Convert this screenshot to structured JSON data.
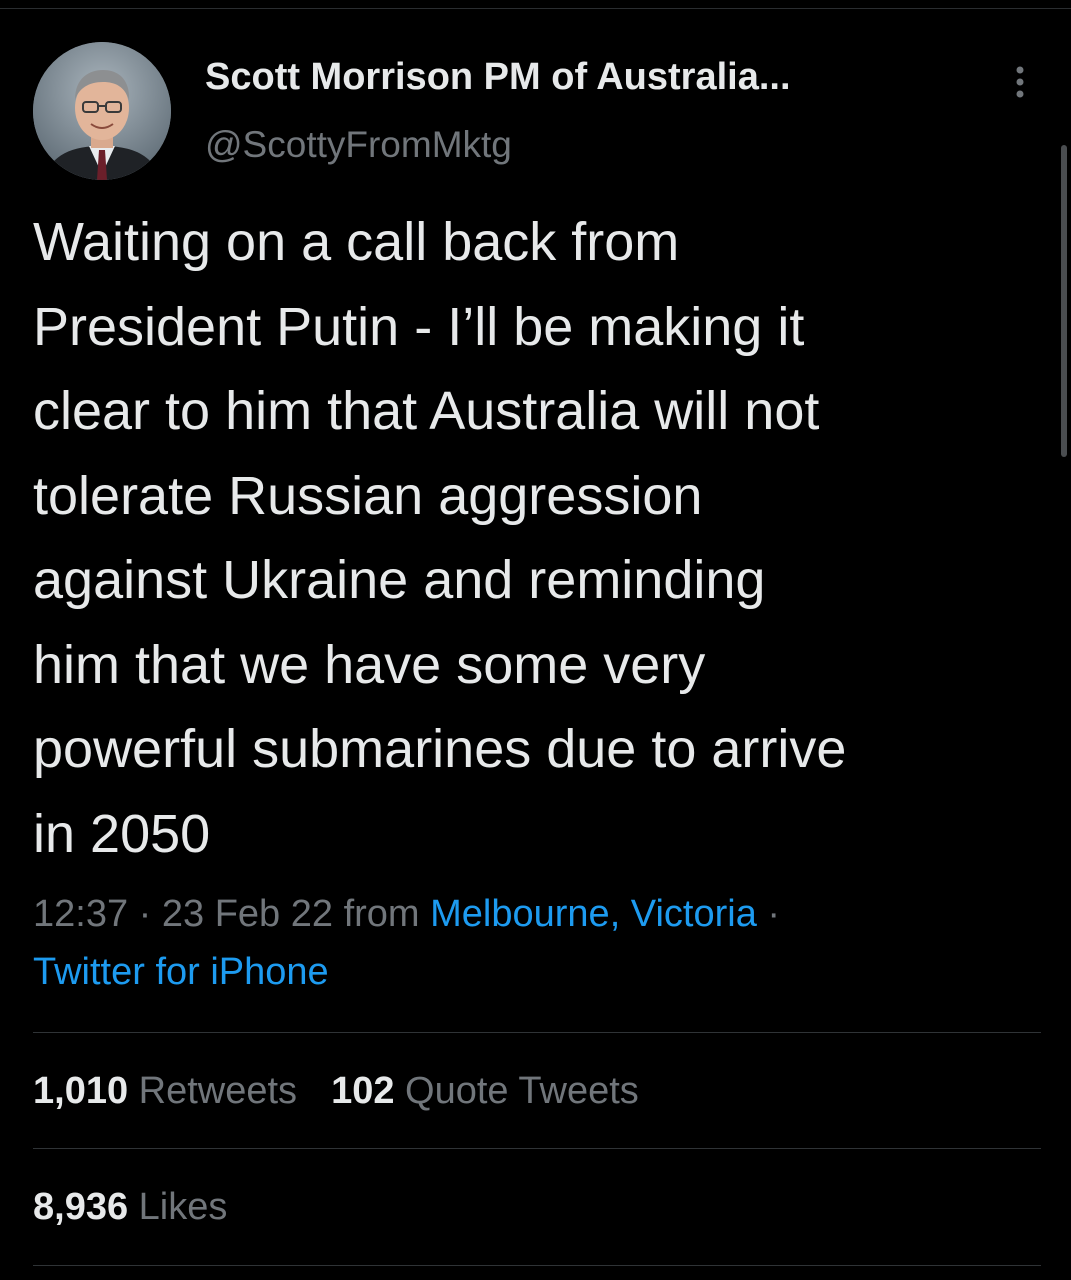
{
  "tweet": {
    "author_name": "Scott Morrison PM of Australia...",
    "author_handle": "@ScottyFromMktg",
    "text_lines": [
      "Waiting on a call back from",
      "President Putin - I’ll be making it",
      "clear to him that Australia will not",
      "tolerate Russian aggression",
      "against Ukraine and reminding",
      "him that we have some very",
      "powerful submarines due to arrive",
      "in 2050"
    ],
    "time": "12:37",
    "separator": " · ",
    "date": "23 Feb 22",
    "from_word": " from ",
    "location": "Melbourne, Victoria",
    "trailing_separator": " ·",
    "source": "Twitter for iPhone"
  },
  "stats": {
    "retweets_count": "1,010",
    "retweets_label": "Retweets",
    "quotes_count": "102",
    "quotes_label": "Quote Tweets",
    "likes_count": "8,936",
    "likes_label": "Likes"
  },
  "icons": {
    "more": "more-vertical-icon",
    "avatar": "profile-avatar"
  },
  "colors": {
    "background": "#000000",
    "primary_text": "#e7e9ea",
    "secondary_text": "#71767b",
    "link": "#1d9bf0",
    "divider": "#2f3336"
  }
}
